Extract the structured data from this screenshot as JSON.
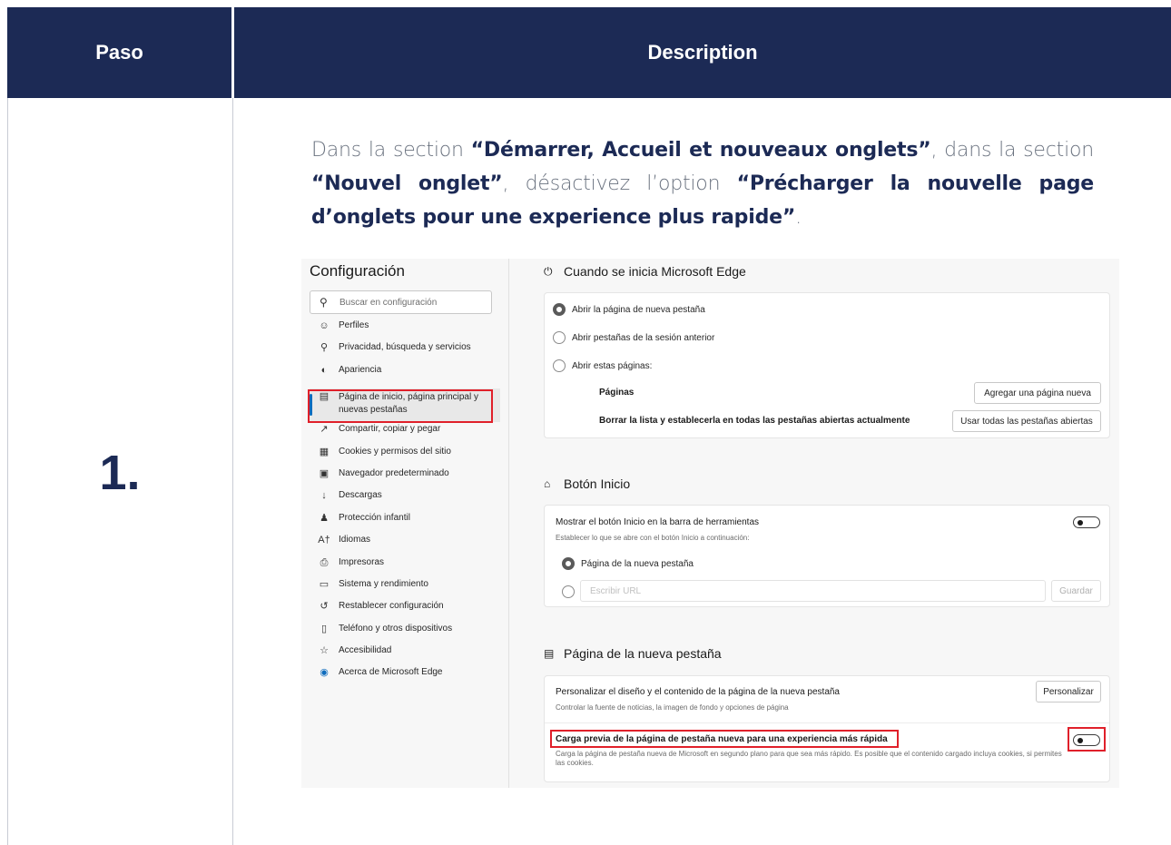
{
  "table": {
    "header": {
      "step_col": "Paso",
      "desc_col": "Description"
    },
    "row": {
      "step": "1.",
      "instruction": {
        "t1": "Dans la section ",
        "b1": "“Démarrer, Accueil et nouveaux onglets”",
        "t2": ", dans la section ",
        "b2": "“Nouvel onglet”",
        "t3": ", désactivez l’option ",
        "b3": "“Précharger la nouvelle page d’onglets pour une experience plus rapide”",
        "t4": "."
      }
    }
  },
  "colors": {
    "header_bg": "#1c2a55",
    "accent_text": "#1c2a55",
    "highlight_red": "#e0202a",
    "active_indicator": "#0f6cbd"
  },
  "screenshot": {
    "sidebar": {
      "title": "Configuración",
      "search_placeholder": "Buscar en configuración",
      "items": [
        {
          "icon": "profile-icon",
          "label": "Perfiles"
        },
        {
          "icon": "lock-icon",
          "label": "Privacidad, búsqueda y servicios"
        },
        {
          "icon": "appearance-icon",
          "label": "Apariencia"
        },
        {
          "icon": "newtab-icon",
          "label": "Página de inicio, página principal y nuevas pestañas",
          "active": true
        },
        {
          "icon": "share-icon",
          "label": "Compartir, copiar y pegar"
        },
        {
          "icon": "cookies-icon",
          "label": "Cookies y permisos del sitio"
        },
        {
          "icon": "browser-icon",
          "label": "Navegador predeterminado"
        },
        {
          "icon": "download-icon",
          "label": "Descargas"
        },
        {
          "icon": "family-icon",
          "label": "Protección infantil"
        },
        {
          "icon": "language-icon",
          "label": "Idiomas"
        },
        {
          "icon": "printer-icon",
          "label": "Impresoras"
        },
        {
          "icon": "laptop-icon",
          "label": "Sistema y rendimiento"
        },
        {
          "icon": "reset-icon",
          "label": "Restablecer configuración"
        },
        {
          "icon": "phone-icon",
          "label": "Teléfono y otros dispositivos"
        },
        {
          "icon": "accessibility-icon",
          "label": "Accesibilidad"
        },
        {
          "icon": "edge-icon",
          "label": "Acerca de Microsoft Edge"
        }
      ]
    },
    "startup": {
      "title": "Cuando se inicia Microsoft Edge",
      "options": [
        "Abrir la página de nueva pestaña",
        "Abrir pestañas de la sesión anterior",
        "Abrir estas páginas:"
      ],
      "selected_index": 0,
      "pages_label": "Páginas",
      "add_page_button": "Agregar una página nueva",
      "clear_label": "Borrar la lista y establecerla en todas las pestañas abiertas actualmente",
      "use_all_button": "Usar todas las pestañas abiertas"
    },
    "home_button": {
      "title": "Botón Inicio",
      "show_label": "Mostrar el botón Inicio en la barra de herramientas",
      "show_desc": "Establecer lo que se abre con el botón Inicio a continuación:",
      "option_newtab": "Página de la nueva pestaña",
      "url_placeholder": "Escribir URL",
      "save_button": "Guardar"
    },
    "new_tab_page": {
      "title": "Página de la nueva pestaña",
      "customize_label": "Personalizar el diseño y el contenido de la página de la nueva pestaña",
      "customize_desc": "Controlar la fuente de noticias, la imagen de fondo y opciones de página",
      "customize_button": "Personalizar",
      "preload_label": "Carga previa de la página de pestaña nueva para una experiencia más rápida",
      "preload_desc": "Carga la página de pestaña nueva de Microsoft en segundo plano para que sea más rápido. Es posible que el contenido cargado incluya cookies, si permites las cookies."
    }
  }
}
